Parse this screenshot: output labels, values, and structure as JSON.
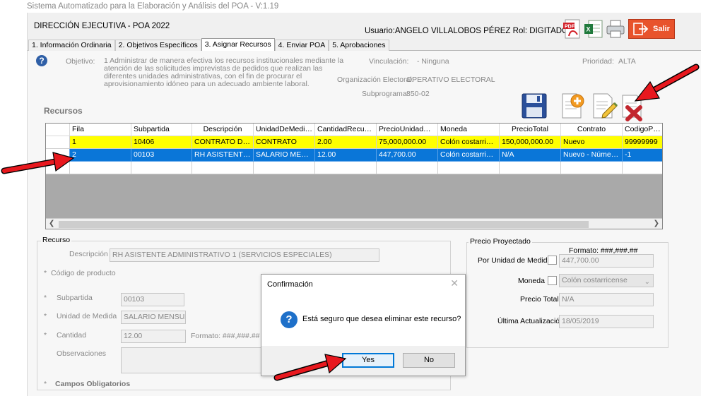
{
  "app": {
    "window_title": "Sistema Automatizado para la Elaboración y Análisis del POA -  V:1.19"
  },
  "header": {
    "department": "DIRECCIÓN EJECUTIVA - POA 2022",
    "user_info": "Usuario:ANGELO VILLALOBOS PÉREZ  Rol: DIGITADOR",
    "toolbar_icons": [
      "pdf-icon",
      "excel-icon",
      "printer-icon"
    ],
    "exit_label": "Salir",
    "exit_color": "#e8532c"
  },
  "tabs": [
    {
      "label": "1. Información Ordinaria"
    },
    {
      "label": "2. Objetivos Específicos"
    },
    {
      "label": "3. Asignar Recursos"
    },
    {
      "label": "4. Enviar POA"
    },
    {
      "label": "5. Aprobaciones"
    }
  ],
  "objective": {
    "label": "Objetivo:",
    "text": "1 Administrar de manera efectiva los recursos institucionales mediante la atención de las solicitudes imprevistas de pedidos que realizan las diferentes unidades administrativas, con el fin de procurar el aprovisionamiento idóneo para un adecuado ambiente laboral.",
    "vinculacion_label": "Vinculación:",
    "vinculacion_value": "- Ninguna",
    "prioridad_label": "Prioridad:",
    "prioridad_value": "ALTA",
    "organizacion_label": "Organización Electoral:",
    "organizacion_value": "OPERATIVO ELECTORAL",
    "subprograma_label": "Subprograma:",
    "subprograma_value": "850-02"
  },
  "actions": [
    "save-icon",
    "add-document-icon",
    "edit-document-icon",
    "delete-icon"
  ],
  "recursos": {
    "title": "Recursos",
    "columns": [
      "Fila",
      "Subpartida",
      "Descripción",
      "UnidadDeMedida",
      "CantidadRecursoSc",
      "PrecioUnidadMedic",
      "Moneda",
      "PrecioTotal",
      "Contrato",
      "CodigoProduc"
    ],
    "rows": [
      [
        "1",
        "10406",
        "CONTRATO DE ...",
        "CONTRATO",
        "2.00",
        "75,000,000.00",
        "Colón costarricen...",
        "150,000,000.00",
        "Nuevo",
        "99999999"
      ],
      [
        "2",
        "00103",
        "RH ASISTENTE ...",
        "SALARIO MENS...",
        "12.00",
        "447,700.00",
        "Colón costarricen...",
        "N/A",
        "Nuevo - Número ...",
        "-1"
      ]
    ],
    "new_row_marker": "*",
    "highlight_colors": {
      "first_row": "#ffff00",
      "selected_row": "#0a76d8"
    }
  },
  "recurso_form": {
    "group_title": "Recurso",
    "descripcion_label": "Descripción",
    "descripcion_value": "RH ASISTENTE ADMINISTRATIVO 1 (SERVICIOS ESPECIALES)",
    "codigo_label": "Código de producto",
    "subpartida_label": "Subpartida",
    "subpartida_value": "00103",
    "unidad_label": "Unidad de Medida",
    "unidad_value": "SALARIO MENSUAI",
    "cantidad_label": "Cantidad",
    "cantidad_value": "12.00",
    "formato_cantidad": "Formato: ###,###.##",
    "observaciones_label": "Observaciones",
    "required_star": "*",
    "obligatorios_label": "Campos Obligatorios"
  },
  "precio": {
    "group_title": "Precio Proyectado",
    "formato": "Formato: ###,###.##",
    "por_unidad_label": "Por Unidad de Medida",
    "por_unidad_value": "447,700.00",
    "moneda_label": "Moneda",
    "moneda_value": "Colón costarricense",
    "precio_total_label": "Precio Total",
    "precio_total_value": "N/A",
    "ultima_label": "Última Actualización",
    "ultima_value": "18/05/2019"
  },
  "dialog": {
    "title": "Confirmación",
    "message": "Está seguro que desea eliminar este recurso?",
    "yes_label": "Yes",
    "no_label": "No"
  },
  "annotations": {
    "arrow_color": "#e8181e"
  }
}
